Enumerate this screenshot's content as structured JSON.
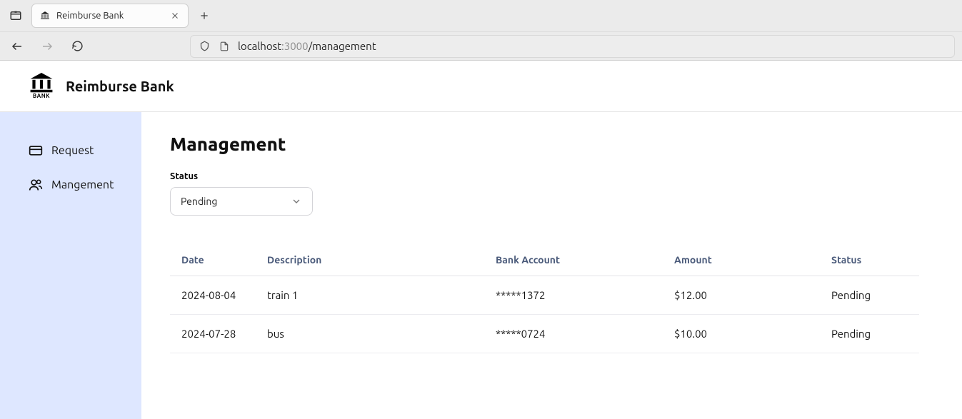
{
  "browser": {
    "tab_title": "Reimburse Bank",
    "url_host": "localhost",
    "url_port": ":3000",
    "url_path": "/management"
  },
  "header": {
    "brand": "Reimburse Bank",
    "logo_sub": "BANK"
  },
  "sidebar": {
    "items": [
      {
        "label": "Request",
        "icon": "card-icon"
      },
      {
        "label": "Mangement",
        "icon": "people-icon"
      }
    ]
  },
  "main": {
    "title": "Management",
    "filter_label": "Status",
    "filter_value": "Pending"
  },
  "table": {
    "headers": {
      "date": "Date",
      "description": "Description",
      "bank": "Bank Account",
      "amount": "Amount",
      "status": "Status"
    },
    "rows": [
      {
        "date": "2024-08-04",
        "description": "train 1",
        "bank": "*****1372",
        "amount": "$12.00",
        "status": "Pending"
      },
      {
        "date": "2024-07-28",
        "description": "bus",
        "bank": "*****0724",
        "amount": "$10.00",
        "status": "Pending"
      }
    ]
  }
}
